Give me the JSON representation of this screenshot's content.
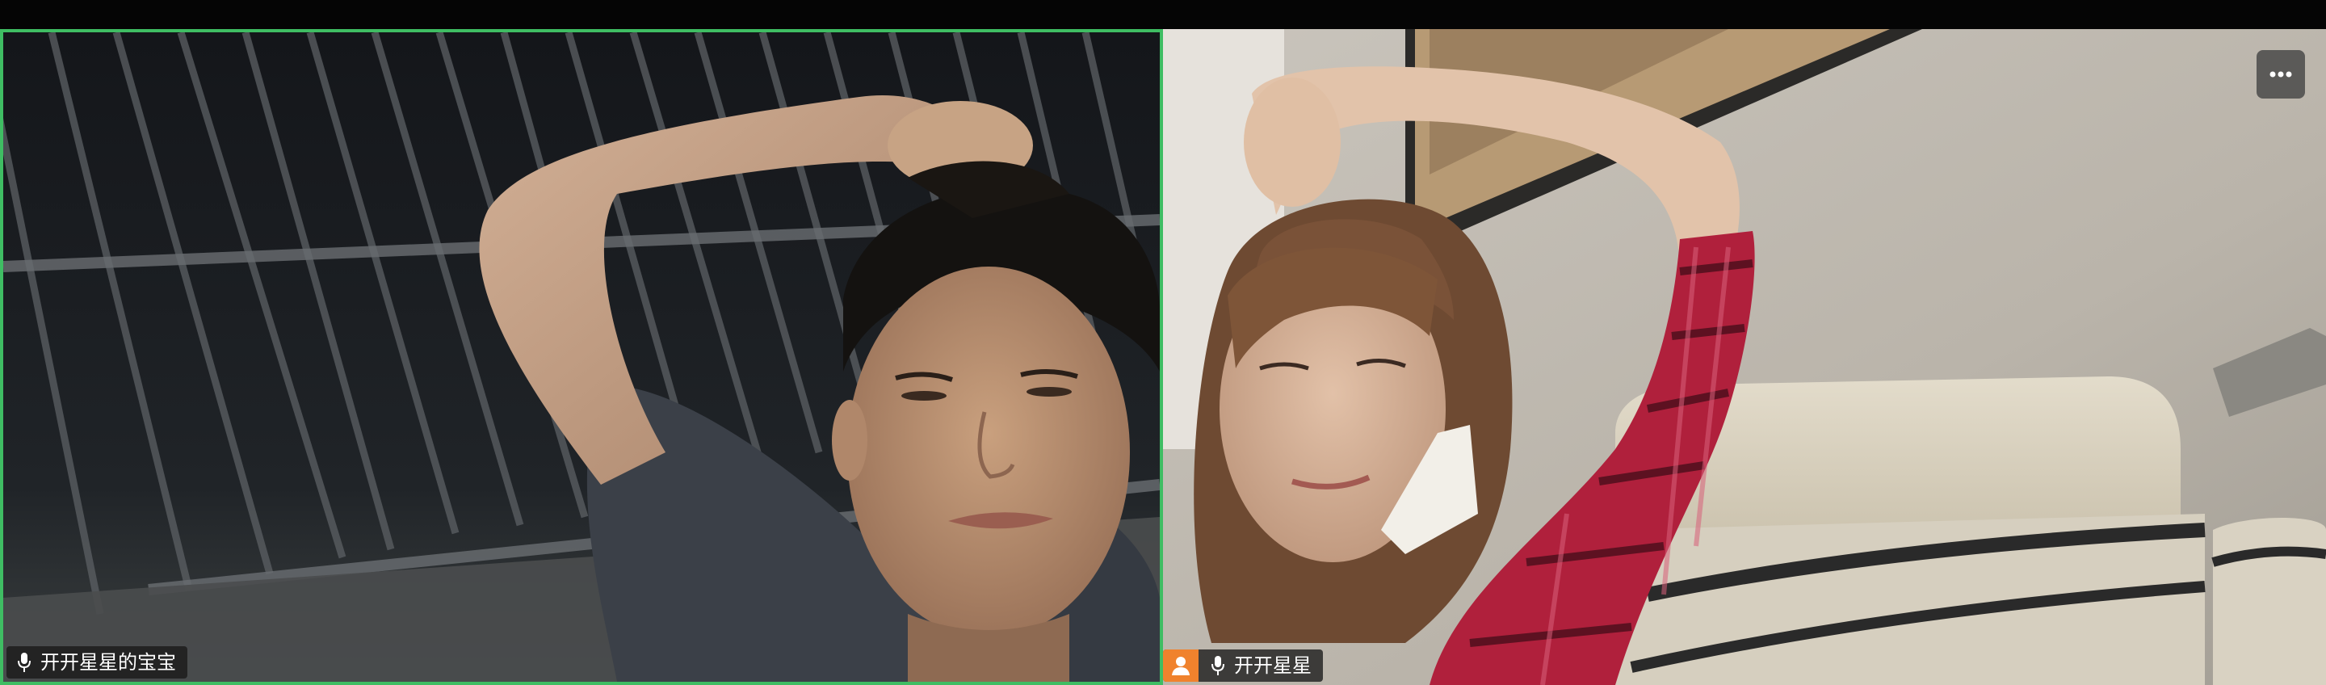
{
  "participants": [
    {
      "name": "开开星星的宝宝",
      "mic_icon": "microphone-icon",
      "active_speaker": true
    },
    {
      "name": "开开星星",
      "avatar_icon": "person-avatar-icon",
      "mic_icon": "microphone-icon",
      "more_icon": "more-options-icon"
    }
  ],
  "colors": {
    "active_speaker_border": "#3fbd63",
    "avatar_orange": "#f0822d",
    "background": "#050505"
  }
}
